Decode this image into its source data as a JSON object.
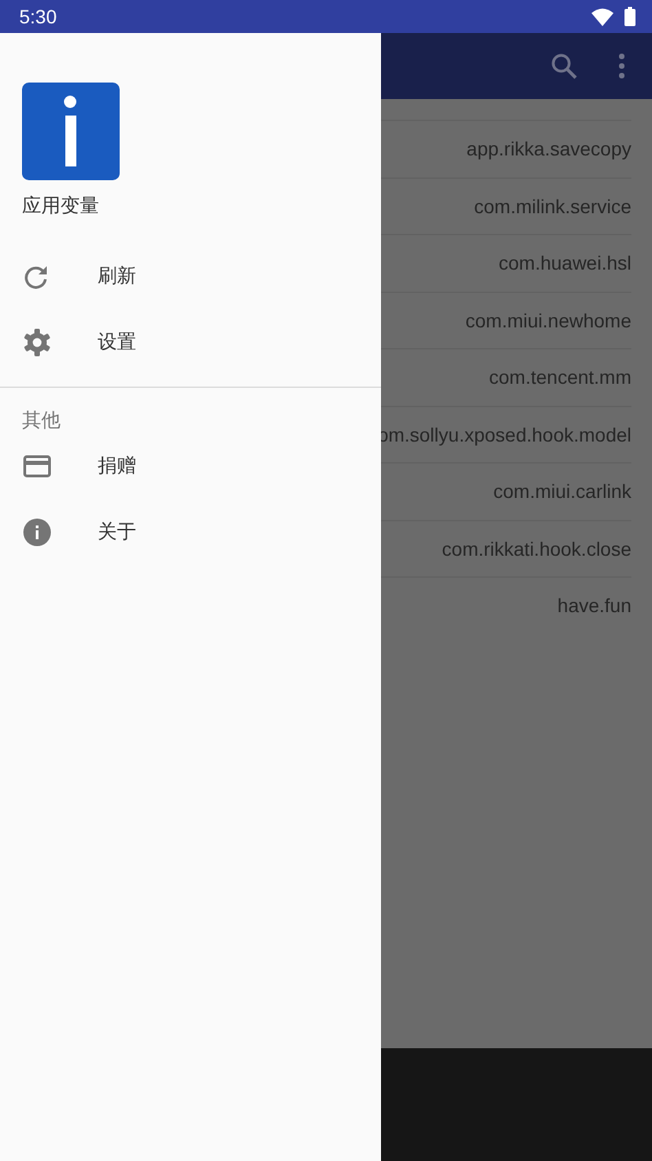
{
  "status_bar": {
    "time": "5:30"
  },
  "package_list": [
    "app.rikka.savecopy",
    "com.milink.service",
    "com.huawei.hsl",
    "com.miui.newhome",
    "com.tencent.mm",
    "om.sollyu.xposed.hook.model",
    "com.miui.carlink",
    "com.rikkati.hook.close",
    "have.fun"
  ],
  "drawer": {
    "app_name": "应用变量",
    "groups": [
      {
        "items": [
          {
            "label": "刷新"
          },
          {
            "label": "设置"
          }
        ]
      },
      {
        "header": "其他",
        "items": [
          {
            "label": "捐赠"
          },
          {
            "label": "关于"
          }
        ]
      }
    ]
  }
}
